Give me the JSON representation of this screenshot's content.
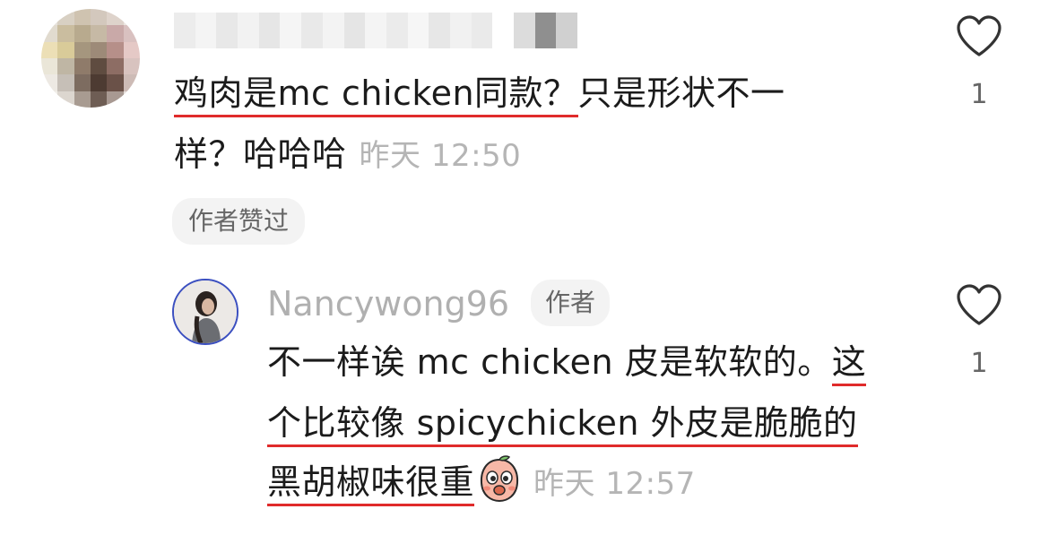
{
  "comment1": {
    "line1_underlined": "鸡肉是mc chicken同款？",
    "line1_rest": "只是形状不一",
    "line2": "样？哈哈哈",
    "time": "昨天 12:50",
    "chip": "作者赞过",
    "like_count": "1"
  },
  "reply": {
    "author": "Nancywong96",
    "badge": "作者",
    "line1_plain": "不一样诶 mc chicken 皮是软软的。",
    "line1_underlined": "这",
    "line2_underlined": "个比较像 spicychicken 外皮是脆脆的",
    "line3_underlined": "黑胡椒味很重",
    "time": "昨天 12:57",
    "like_count": "1"
  },
  "icons": {
    "heart": "heart-outline-icon",
    "emoji": "peach-face-emoji"
  },
  "colors": {
    "underline": "#e02b2b",
    "muted": "#b5b5b5",
    "chip_bg": "#f3f3f3",
    "avatar_border": "#3b4fc0"
  }
}
